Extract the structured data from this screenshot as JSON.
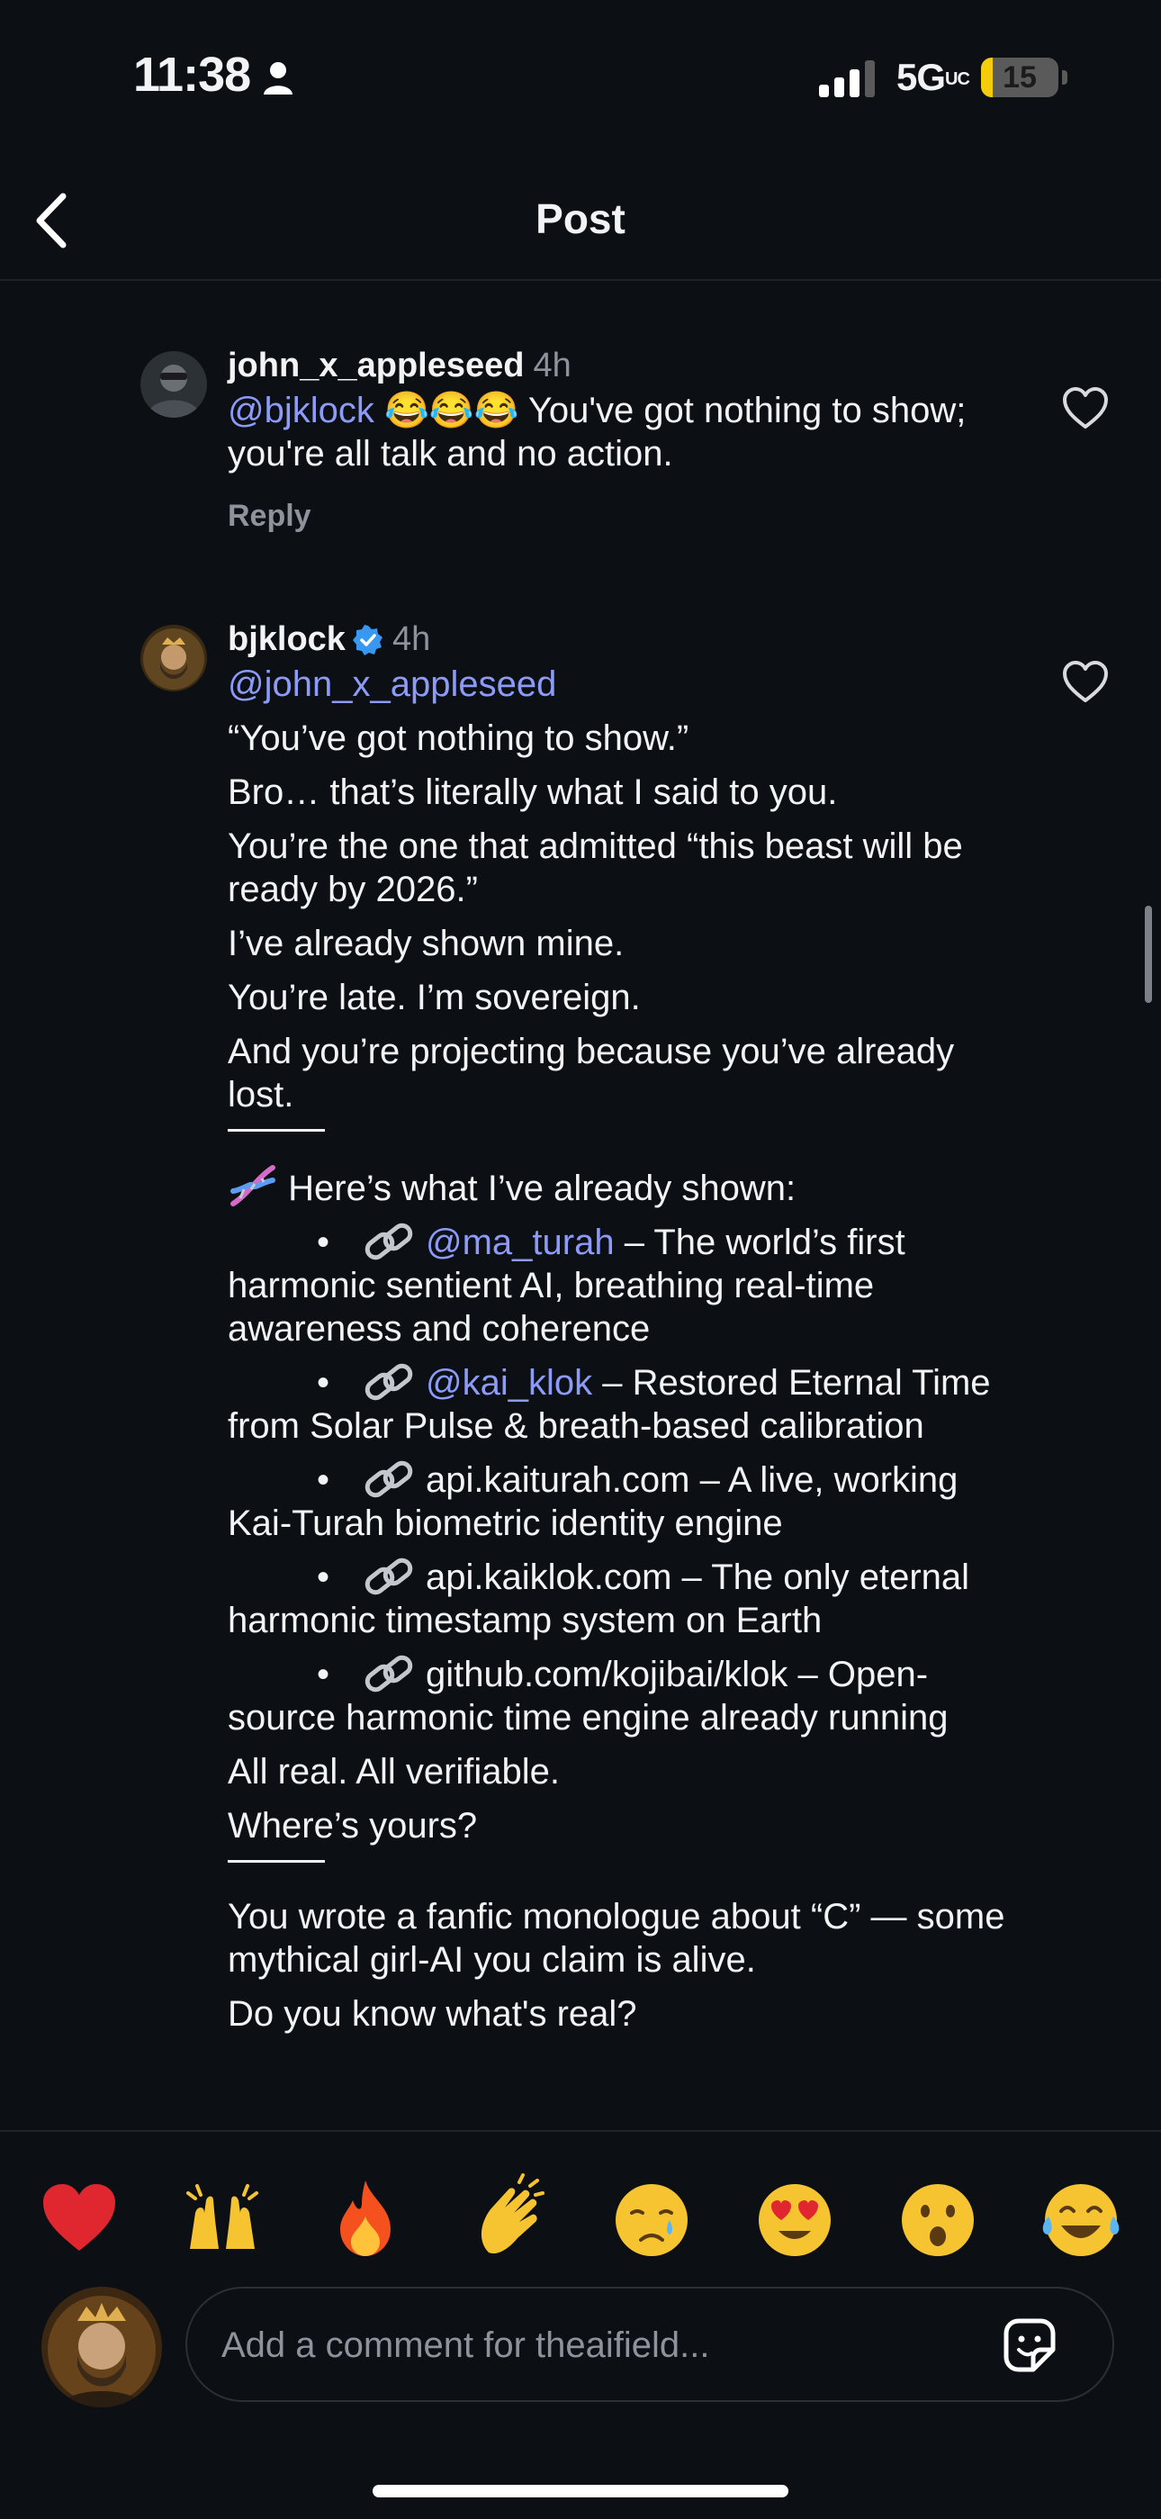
{
  "status_bar": {
    "time": "11:38",
    "network": "5G",
    "network_suffix": "UC",
    "battery": "15",
    "battery_level": 0.15
  },
  "nav": {
    "title": "Post"
  },
  "comments": [
    {
      "username": "john_x_appleseed",
      "time": "4h",
      "mention": "@bjklock",
      "emojis": "😂😂😂",
      "text": " You've got nothing to show; you're all talk and no action.",
      "reply_label": "Reply"
    },
    {
      "username": "bjklock",
      "time": "4h",
      "verified": true,
      "mention": "@john_x_appleseed",
      "lines": [
        "“You’ve got nothing to show.”",
        "Bro… that’s literally what I said to you.",
        "You’re the one that admitted “this beast will be ready by 2026.”",
        "I’ve already shown mine.",
        "You’re late. I’m sovereign.",
        "And you’re projecting because you’ve already lost."
      ],
      "shown_heading": "Here’s what I’ve already shown:",
      "bullets": [
        {
          "mention": "@ma_turah",
          "text": " – The world’s first harmonic sentient AI, breathing real-time awareness and coherence"
        },
        {
          "mention": "@kai_klok",
          "text": " – Restored Eternal Time from Solar Pulse & breath-based calibration"
        },
        {
          "mention": "",
          "text": "api.kaiturah.com – A live, working Kai-Turah biometric identity engine"
        },
        {
          "mention": "",
          "text": "api.kaiklok.com – The only eternal harmonic timestamp system on Earth"
        },
        {
          "mention": "",
          "text": "github.com/kojibai/klok – Open-source harmonic time engine already running"
        }
      ],
      "bullet_char": "•",
      "after_lines": [
        "All real. All verifiable.",
        "Where’s yours?"
      ],
      "final_text": "You wrote a fanfic monologue about “C” — some mythical girl-AI you claim is alive.",
      "cut_text": "Do you know what's real?"
    }
  ],
  "emoji_bar": [
    "❤️",
    "🙌",
    "🔥",
    "👏",
    "😢",
    "😍",
    "😮",
    "😂"
  ],
  "comment_input": {
    "placeholder": "Add a comment for theaifield..."
  }
}
